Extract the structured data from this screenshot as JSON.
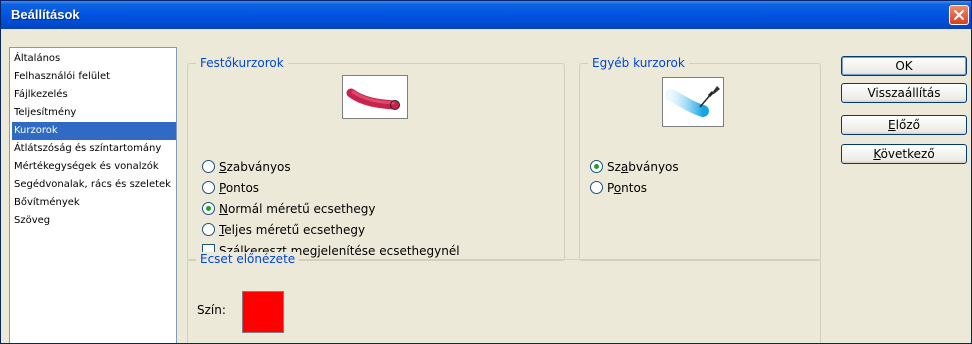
{
  "window": {
    "title": "Beállítások"
  },
  "sidebar": {
    "items": [
      {
        "label": "Általános"
      },
      {
        "label": "Felhasználói felület"
      },
      {
        "label": "Fájlkezelés"
      },
      {
        "label": "Teljesítmény"
      },
      {
        "label": "Kurzorok",
        "selected": true
      },
      {
        "label": "Átlátszóság és színtartomány"
      },
      {
        "label": "Mértékegységek és vonalzók"
      },
      {
        "label": "Segédvonalak, rács és szeletek"
      },
      {
        "label": "Bővítmények"
      },
      {
        "label": "Szöveg"
      }
    ]
  },
  "painting_cursors": {
    "legend": "Festőkurzorok",
    "options": [
      {
        "pre": "",
        "key": "S",
        "post": "zabványos",
        "checked": false
      },
      {
        "pre": "",
        "key": "P",
        "post": "ontos",
        "checked": false
      },
      {
        "pre": "",
        "key": "N",
        "post": "ormál méretű ecsethegy",
        "checked": true
      },
      {
        "pre": "",
        "key": "T",
        "post": "eljes méretű ecsethegy",
        "checked": false
      }
    ],
    "checkbox": {
      "pre": "",
      "key": "S",
      "post": "zálkereszt megjelenítése ecsethegynél",
      "checked": false
    }
  },
  "other_cursors": {
    "legend": "Egyéb kurzorok",
    "options": [
      {
        "pre": "Sz",
        "key": "a",
        "post": "bványos",
        "checked": true
      },
      {
        "pre": "P",
        "key": "o",
        "post": "ntos",
        "checked": false
      }
    ]
  },
  "brush_preview": {
    "legend": "Ecset előnézete",
    "color_label": "Szín:",
    "color": "#ff0000"
  },
  "buttons": {
    "ok": {
      "pre": "OK",
      "key": "",
      "post": ""
    },
    "reset": {
      "pre": "Visszaállítás",
      "key": "",
      "post": ""
    },
    "prev": {
      "pre": "",
      "key": "E",
      "post": "lőző"
    },
    "next": {
      "pre": "",
      "key": "K",
      "post": "övetkező"
    }
  },
  "colors": {
    "title_bar": "#0054e3",
    "selection": "#316ac5",
    "legend_text": "#0046d5",
    "dialog_bg": "#ece9d8"
  },
  "icons": [
    "close-icon",
    "paint-stroke-icon",
    "eyedropper-icon"
  ]
}
